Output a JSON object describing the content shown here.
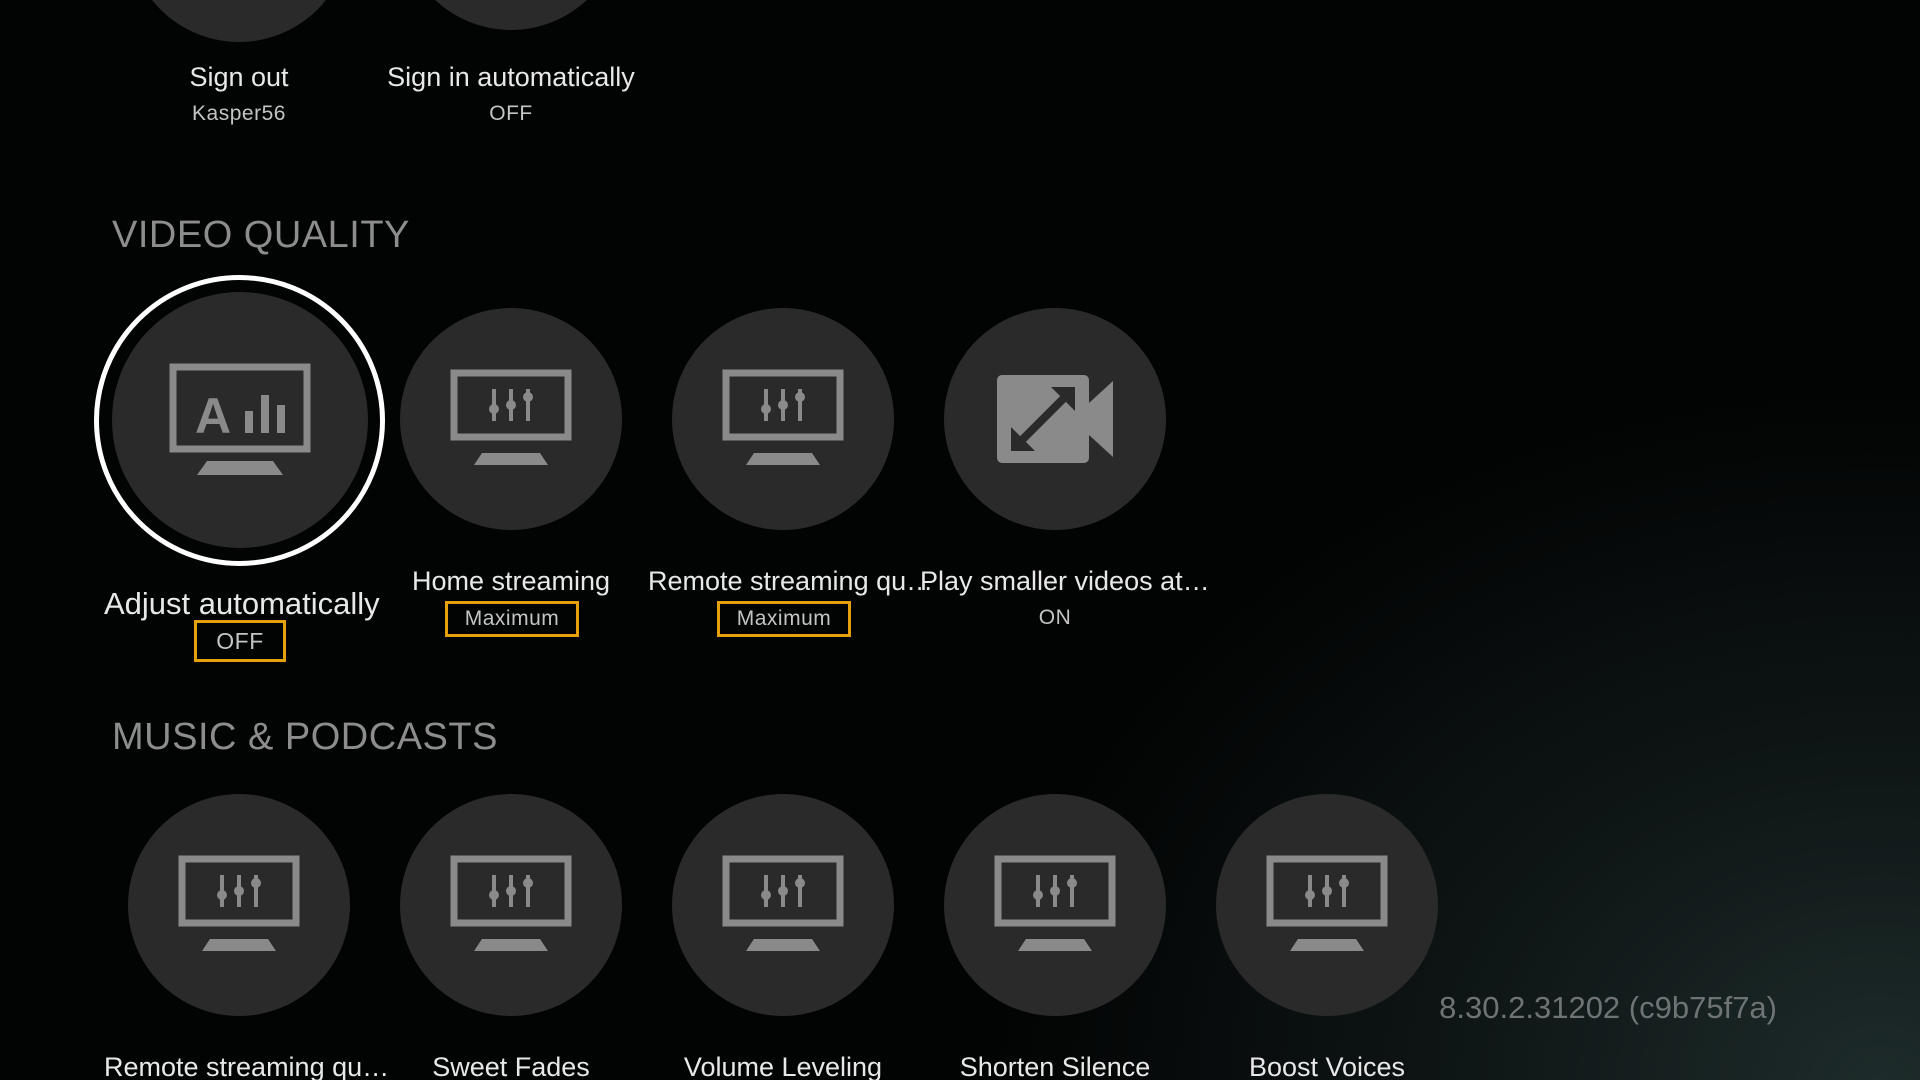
{
  "account": {
    "items": [
      {
        "label": "Sign out",
        "value": "Kasper56"
      },
      {
        "label": "Sign in automatically",
        "value": "OFF"
      }
    ]
  },
  "video_quality": {
    "header": "VIDEO QUALITY",
    "items": [
      {
        "label": "Adjust automatically",
        "value": "OFF",
        "icon": "auto-quality-monitor-icon"
      },
      {
        "label": "Home streaming",
        "value": "Maximum",
        "icon": "monitor-sliders-icon"
      },
      {
        "label": "Remote streaming qu…",
        "value": "Maximum",
        "icon": "monitor-sliders-icon"
      },
      {
        "label": "Play smaller videos at…",
        "value": "ON",
        "icon": "video-expand-icon"
      }
    ]
  },
  "music_podcasts": {
    "header": "MUSIC & PODCASTS",
    "items": [
      {
        "label": "Remote streaming qu…",
        "icon": "monitor-sliders-icon"
      },
      {
        "label": "Sweet Fades",
        "icon": "monitor-sliders-icon"
      },
      {
        "label": "Volume Leveling",
        "icon": "monitor-sliders-icon"
      },
      {
        "label": "Shorten Silence",
        "icon": "monitor-sliders-icon"
      },
      {
        "label": "Boost Voices",
        "icon": "monitor-sliders-icon"
      }
    ]
  },
  "version": "8.30.2.31202 (c9b75f7a)",
  "colors": {
    "accent": "#e5a00d",
    "tile_background": "#2a2a2a",
    "icon": "#8a8a8a",
    "header": "#8d8d8d"
  }
}
